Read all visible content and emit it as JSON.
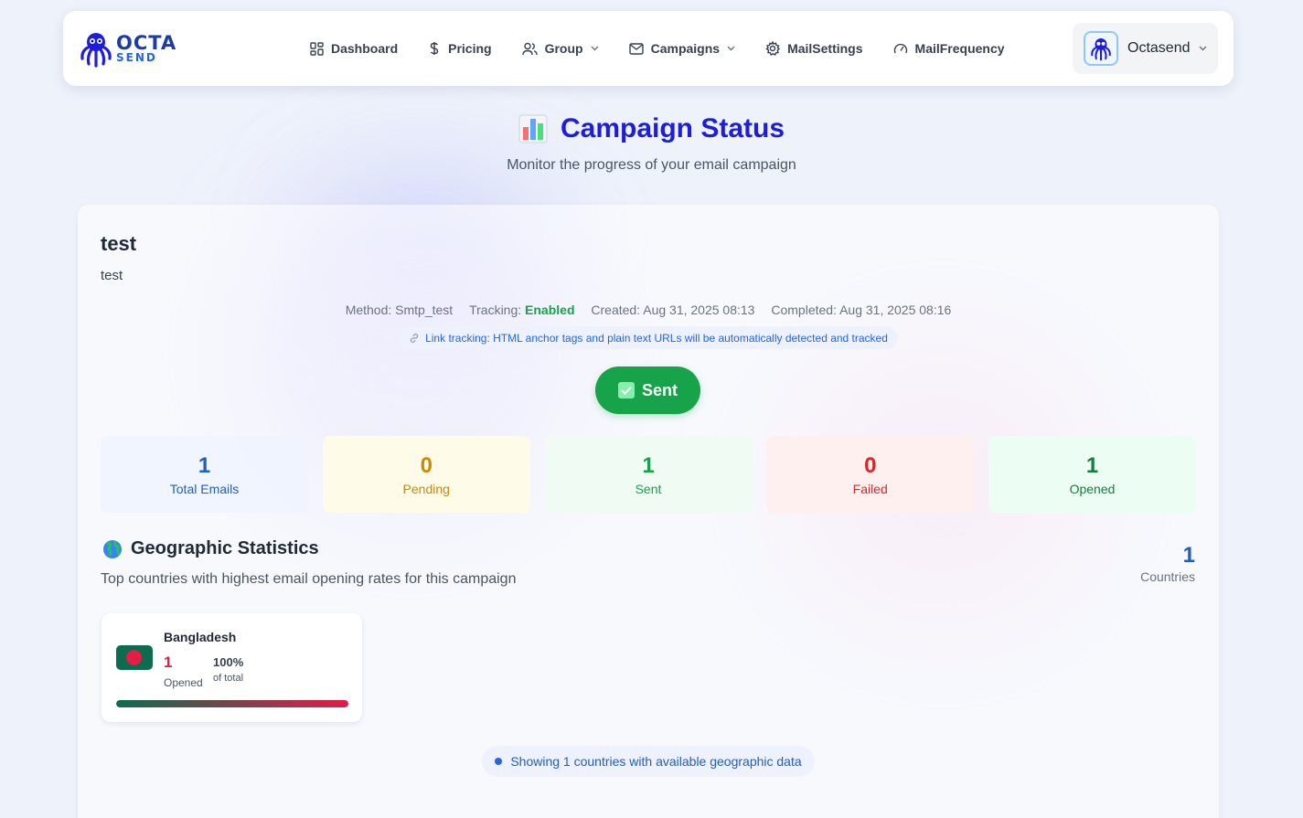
{
  "brand": {
    "logo_top": "OCTA",
    "logo_bottom": "SEND"
  },
  "nav": {
    "items": [
      {
        "label": "Dashboard",
        "icon": "dashboard-icon"
      },
      {
        "label": "Pricing",
        "icon": "dollar-icon"
      },
      {
        "label": "Group",
        "icon": "users-icon",
        "dropdown": true
      },
      {
        "label": "Campaigns",
        "icon": "mail-icon",
        "dropdown": true
      },
      {
        "label": "MailSettings",
        "icon": "gear-icon"
      },
      {
        "label": "MailFrequency",
        "icon": "gauge-icon"
      }
    ]
  },
  "user": {
    "name": "Octasend"
  },
  "page": {
    "title": "Campaign Status",
    "subtitle": "Monitor the progress of your email campaign"
  },
  "campaign": {
    "name": "test",
    "description": "test",
    "method_label": "Method:",
    "method": "Smtp_test",
    "tracking_label": "Tracking:",
    "tracking": "Enabled",
    "created_label": "Created:",
    "created": "Aug 31, 2025 08:13",
    "completed_label": "Completed:",
    "completed": "Aug 31, 2025 08:16",
    "link_note": "Link tracking: HTML anchor tags and plain text URLs will be automatically detected and tracked",
    "status": "Sent"
  },
  "stats": {
    "total": {
      "value": "1",
      "label": "Total Emails"
    },
    "pending": {
      "value": "0",
      "label": "Pending"
    },
    "sent": {
      "value": "1",
      "label": "Sent"
    },
    "failed": {
      "value": "0",
      "label": "Failed"
    },
    "opened": {
      "value": "1",
      "label": "Opened"
    }
  },
  "geo": {
    "title": "Geographic Statistics",
    "subtitle": "Top countries with highest email opening rates for this campaign",
    "countries_count": "1",
    "countries_label": "Countries",
    "countries": [
      {
        "name": "Bangladesh",
        "opened": "1",
        "opened_label": "Opened",
        "percent": "100%",
        "percent_label": "of total",
        "share": 1.0
      }
    ],
    "footnote": "Showing 1 countries with available geographic data"
  },
  "colors": {
    "primary": "#1d1de0",
    "success": "#16a34a",
    "danger": "#dc2626",
    "warning": "#ca8a04",
    "info": "#1d5ec7"
  }
}
